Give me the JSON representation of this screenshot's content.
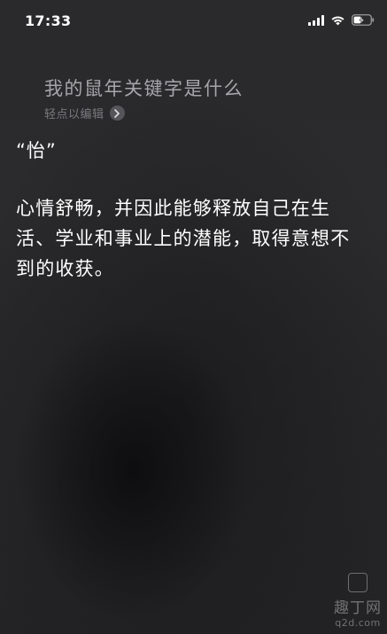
{
  "status_bar": {
    "time": "17:33",
    "icons": [
      "signal-icon",
      "wifi-icon",
      "battery-charging-icon"
    ]
  },
  "siri": {
    "query": "我的鼠年关键字是什么",
    "edit_hint": "轻点以编辑",
    "edit_icon": "chevron-right-icon"
  },
  "answer": {
    "keyword": "“怡”",
    "description": "心情舒畅，并因此能够释放自己在生活、学业和事业上的潜能，取得意想不到的收获。"
  },
  "watermark": {
    "brand": "趣丁网",
    "url": "q2d.com"
  }
}
